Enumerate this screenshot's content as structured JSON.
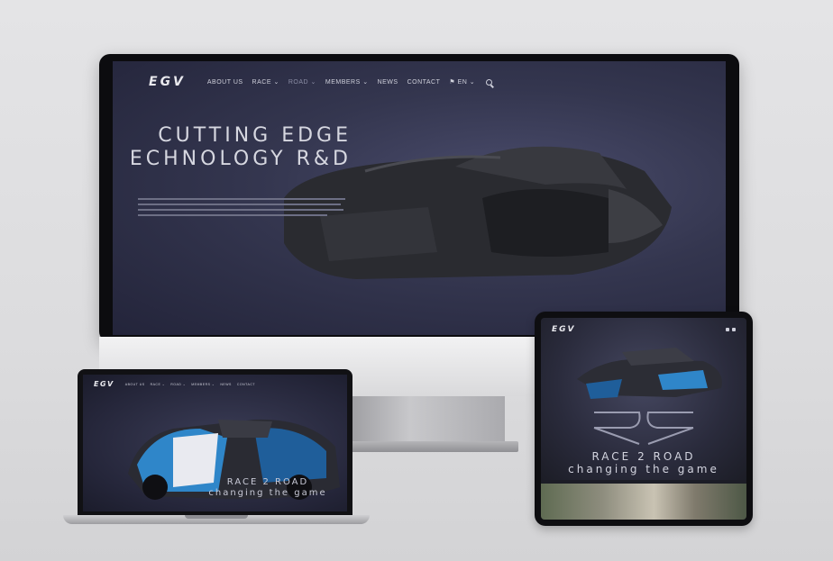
{
  "desktop": {
    "logo": "EGV",
    "nav": [
      {
        "label": "ABOUT US"
      },
      {
        "label": "RACE ⌄"
      },
      {
        "label": "ROAD ⌄"
      },
      {
        "label": "MEMBERS ⌄"
      },
      {
        "label": "NEWS"
      },
      {
        "label": "CONTACT"
      },
      {
        "label": "⚑ EN ⌄"
      }
    ],
    "hero_title_line1": "CUTTING EDGE",
    "hero_title_line2": "ECHNOLOGY R&D"
  },
  "laptop": {
    "logo": "EGV",
    "tagline_line1": "RACE 2 ROAD",
    "tagline_line2": "changing the game"
  },
  "tablet": {
    "logo": "EGV",
    "title_line1": "RACE 2 ROAD",
    "title_line2": "changing the game"
  },
  "colors": {
    "screen_dark": "#23243a",
    "text_light": "#d6d7e0",
    "car_blue": "#2f86c9"
  },
  "icons": [
    "search-icon",
    "menu-icon"
  ]
}
